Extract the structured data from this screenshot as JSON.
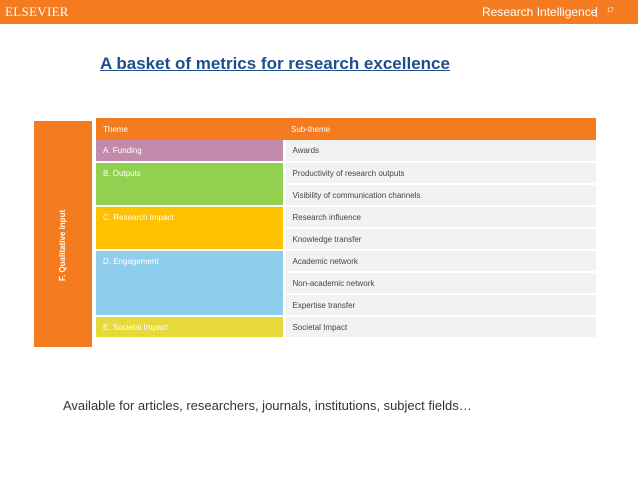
{
  "header": {
    "brand": "ELSEVIER",
    "product": "Research Intelligence",
    "page_number": "17",
    "bar_color": "#f47b20"
  },
  "slide": {
    "title": "A basket of metrics for research excellence",
    "side_label": "F. Qualitative input",
    "footer": "Available for articles, researchers, journals, institutions, subject fields…"
  },
  "table": {
    "headers": [
      "Theme",
      "Sub-theme"
    ],
    "themes": [
      {
        "label": "A. Funding",
        "color": "#c38bab",
        "subthemes": [
          "Awards"
        ]
      },
      {
        "label": "B. Outputs",
        "color": "#92d050",
        "subthemes": [
          "Productivity of research outputs",
          "Visibility of communication channels"
        ]
      },
      {
        "label": "C. Research Impact",
        "color": "#ffc000",
        "subthemes": [
          "Research influence",
          "Knowledge transfer"
        ]
      },
      {
        "label": "D. Engagement",
        "color": "#8fcdec",
        "subthemes": [
          "Academic network",
          "Non-academic network",
          "Expertise transfer"
        ]
      },
      {
        "label": "E. Societal Impact",
        "color": "#e6d939",
        "subthemes": [
          "Societal Impact"
        ]
      }
    ]
  }
}
